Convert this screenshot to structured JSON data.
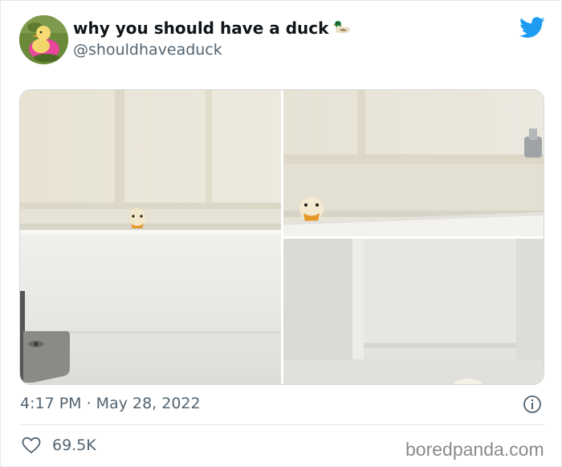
{
  "tweet": {
    "display_name": "why you should have a duck",
    "name_emoji": "🦆",
    "handle": "@shouldhaveaduck",
    "timestamp": "4:17 PM · May 28, 2022",
    "likes": "69.5K"
  },
  "media": {
    "photo_count": 3
  },
  "watermark": {
    "text": "boredpanda.com"
  },
  "colors": {
    "twitter_blue": "#1d9bf0",
    "secondary_text": "#536471",
    "primary_text": "#0f1419"
  },
  "icons": {
    "brand": "twitter-bird-icon",
    "info": "info-icon",
    "like": "heart-icon"
  }
}
